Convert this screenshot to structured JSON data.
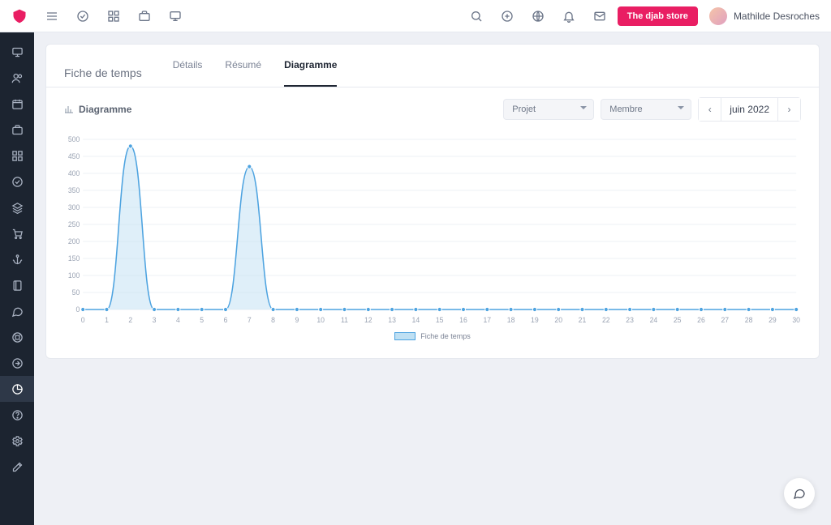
{
  "header": {
    "store_button": "The djab store",
    "user_name": "Mathilde Desroches",
    "top_icons": [
      "menu",
      "check",
      "grid",
      "briefcase",
      "monitor"
    ],
    "right_icons": [
      "search",
      "plus",
      "globe",
      "bell",
      "mail"
    ]
  },
  "rail": {
    "items": [
      "monitor",
      "users",
      "calendar",
      "briefcase",
      "dashboard",
      "check-circle",
      "layers",
      "cart",
      "anchor",
      "notebook",
      "chat",
      "life-ring",
      "arrow-circle",
      "pie",
      "help",
      "settings",
      "edit"
    ],
    "active_index": 13
  },
  "page": {
    "title": "Fiche de temps",
    "tabs": [
      "Détails",
      "Résumé",
      "Diagramme"
    ],
    "active_tab": 2,
    "subtitle": "Diagramme",
    "filters": {
      "projet": "Projet",
      "membre": "Membre",
      "month": "juin 2022"
    },
    "legend": "Fiche de temps"
  },
  "chart_data": {
    "type": "area",
    "title": "",
    "xlabel": "",
    "ylabel": "",
    "ylim": [
      0,
      500
    ],
    "y_ticks": [
      0,
      50,
      100,
      150,
      200,
      250,
      300,
      350,
      400,
      450,
      500
    ],
    "x": [
      0,
      1,
      2,
      3,
      4,
      5,
      6,
      7,
      8,
      9,
      10,
      11,
      12,
      13,
      14,
      15,
      16,
      17,
      18,
      19,
      20,
      21,
      22,
      23,
      24,
      25,
      26,
      27,
      28,
      29,
      30
    ],
    "values": [
      0,
      0,
      480,
      0,
      0,
      0,
      0,
      420,
      0,
      0,
      0,
      0,
      0,
      0,
      0,
      0,
      0,
      0,
      0,
      0,
      0,
      0,
      0,
      0,
      0,
      0,
      0,
      0,
      0,
      0,
      0
    ],
    "legend": [
      "Fiche de temps"
    ]
  }
}
